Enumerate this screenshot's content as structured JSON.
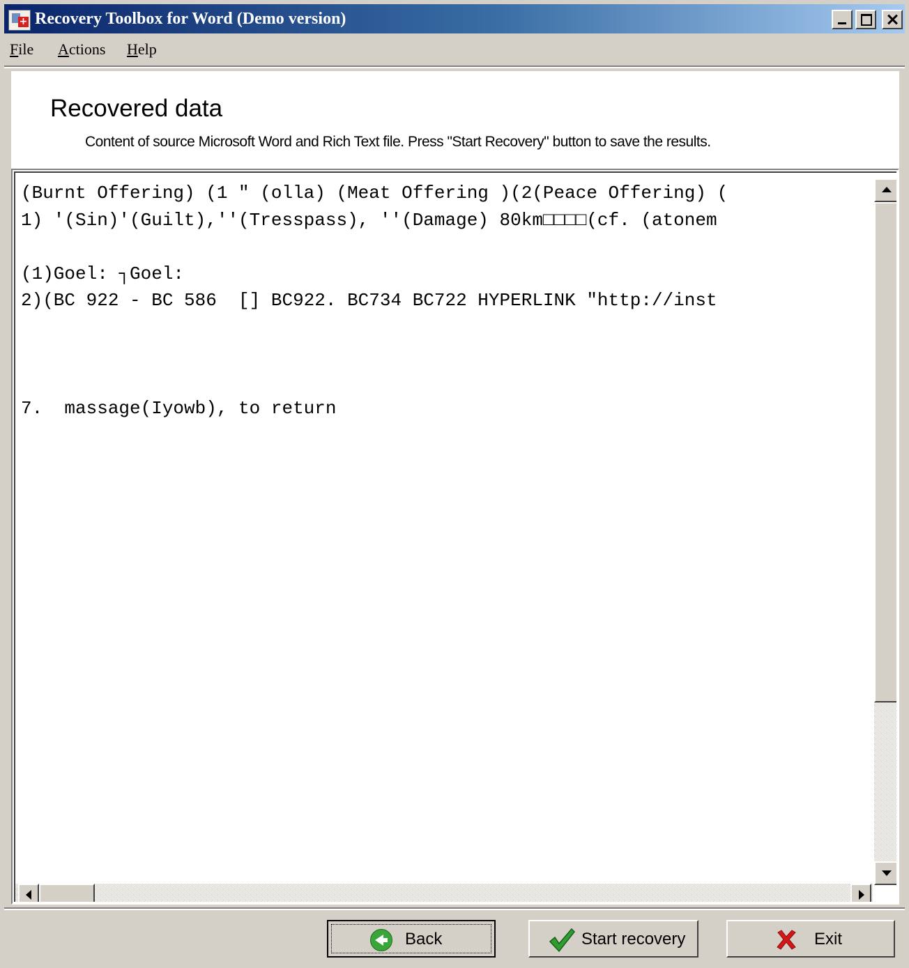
{
  "window": {
    "title": "Recovery Toolbox for Word (Demo version)"
  },
  "menu": [
    {
      "label": "File"
    },
    {
      "label": "Actions"
    },
    {
      "label": "Help"
    }
  ],
  "header": {
    "title": "Recovered data",
    "subtitle": "Content of source Microsoft Word and Rich Text file. Press \"Start Recovery\" button to save the results."
  },
  "content": {
    "lines": [
      "(Burnt Offering) (1 ″ (olla) (Meat Offering )(2(Peace Offering) (",
      "1) '(Sin)'(Guilt),''(Tresspass), ''(Damage) 80km□□□□(cf. (atonem",
      "",
      "(1)Goel: ┐Goel:",
      "2)(BC 922 - BC 586  [] BC922. BC734 BC722 HYPERLINK \"http://inst",
      "",
      "",
      "",
      "7.  massage(Iyowb), to return"
    ]
  },
  "buttons": {
    "back": "Back",
    "start": "Start recovery",
    "exit": "Exit"
  },
  "icons": {
    "app": "recovery-toolbox-icon",
    "back": "back-arrow-icon",
    "start": "checkmark-icon",
    "exit": "red-x-icon"
  },
  "colors": {
    "title_gradient_start": "#0a246a",
    "title_gradient_end": "#a6caf0",
    "face": "#d4d0c8",
    "check_green": "#2f9e2f",
    "exit_red": "#d01818"
  }
}
